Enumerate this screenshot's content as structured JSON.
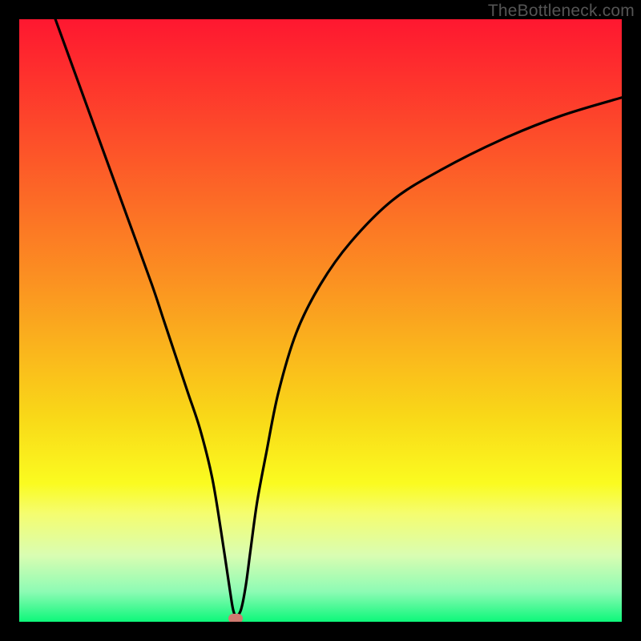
{
  "watermark": "TheBottleneck.com",
  "chart_data": {
    "type": "line",
    "title": "",
    "xlabel": "",
    "ylabel": "",
    "xlim": [
      0,
      100
    ],
    "ylim": [
      0,
      100
    ],
    "grid": false,
    "background_gradient": {
      "direction": "vertical",
      "stops": [
        {
          "pos": 0.0,
          "color": "#FE1730"
        },
        {
          "pos": 0.22,
          "color": "#FD5429"
        },
        {
          "pos": 0.44,
          "color": "#FB9321"
        },
        {
          "pos": 0.66,
          "color": "#F9D818"
        },
        {
          "pos": 0.77,
          "color": "#FAFB20"
        },
        {
          "pos": 0.82,
          "color": "#F5FD6F"
        },
        {
          "pos": 0.89,
          "color": "#D9FDB2"
        },
        {
          "pos": 0.95,
          "color": "#8DFBB4"
        },
        {
          "pos": 1.0,
          "color": "#0DF77A"
        }
      ]
    },
    "series": [
      {
        "name": "bottleneck-curve",
        "color": "#000000",
        "x": [
          6,
          10,
          14,
          18,
          22,
          24,
          26,
          28,
          30,
          32,
          33.5,
          35,
          35.5,
          36,
          36.8,
          37.6,
          38.4,
          39.5,
          41,
          43,
          46,
          50,
          55,
          62,
          70,
          80,
          90,
          100
        ],
        "y": [
          100,
          89,
          78,
          67,
          56,
          50,
          44,
          38,
          32,
          24,
          15,
          5,
          2,
          1,
          2,
          6,
          12,
          20,
          28,
          38,
          48,
          56,
          63,
          70,
          75,
          80,
          84,
          87
        ]
      }
    ],
    "markers": [
      {
        "name": "bottleneck-point",
        "x": 35.9,
        "y": 0.5,
        "color": "#cf7a70",
        "shape": "pill"
      }
    ]
  }
}
